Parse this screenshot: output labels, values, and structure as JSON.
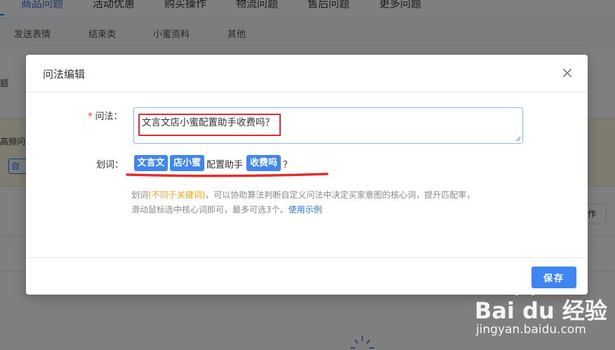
{
  "background": {
    "top_tabs": [
      "商品问题",
      "活动优惠",
      "购买操作",
      "物流问题",
      "售后问题",
      "更多问题"
    ],
    "sub_tabs": [
      "发送表情",
      "结束类",
      "小蜜资料",
      "其他"
    ],
    "left_text_1": "题",
    "left_text_2": "高频问",
    "chip_text": "自动",
    "right_button": "作"
  },
  "dialog": {
    "title": "问法编辑",
    "question_label": "问法：",
    "required_mark": "*",
    "question_value": "文言文店小蜜配置助手收费吗？",
    "segment_label": "划词：",
    "segments": [
      {
        "text": "文言文",
        "selected": true
      },
      {
        "text": "店小蜜",
        "selected": true
      },
      {
        "text": "配置助手",
        "selected": false
      },
      {
        "text": "收费吗",
        "selected": true
      },
      {
        "text": "？",
        "selected": false
      }
    ],
    "hint_prefix": "划词",
    "hint_highlight": "(不同于关键词)",
    "hint_line1_rest": "，可以协助算法判断自定义问法中决定买家意图的核心词，提升匹配率，",
    "hint_line2": "滑动鼠标选中核心词即可，最多可选3个。",
    "hint_link": "使用示例",
    "save_label": "保存"
  },
  "watermark": {
    "logo": "Bai du 经验",
    "url": "jingyan.baidu.com"
  },
  "colors": {
    "primary": "#3f86f0",
    "annotation_red": "#e52c2c",
    "hint_orange": "#f0a31c",
    "required_red": "#e54545"
  }
}
